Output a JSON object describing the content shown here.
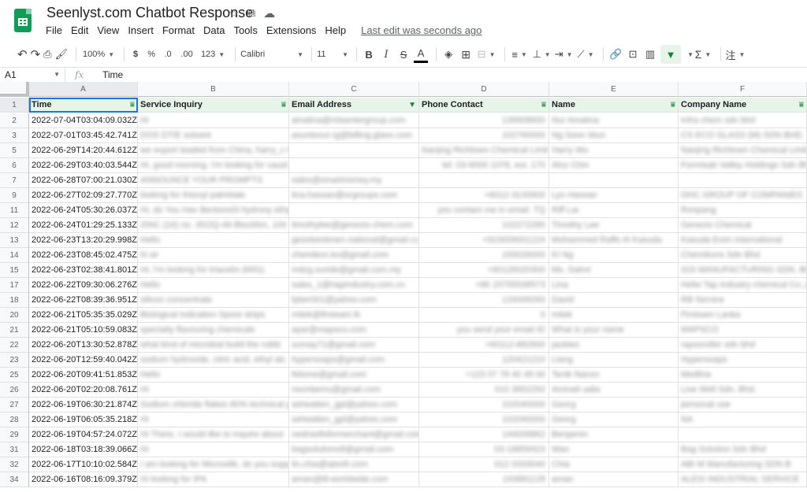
{
  "doc": {
    "title": "Seenlyst.com Chatbot Response",
    "icons": [
      "star-icon",
      "move-to-folder-icon",
      "cloud-status-icon"
    ]
  },
  "menu": [
    "File",
    "Edit",
    "View",
    "Insert",
    "Format",
    "Data",
    "Tools",
    "Extensions",
    "Help"
  ],
  "last_edit": "Last edit was seconds ago",
  "toolbar": {
    "zoom": "100%",
    "currency": "$",
    "percent": "%",
    "dec_less": ".0",
    "dec_more": ".00",
    "number_format": "123",
    "font": "Calibri",
    "font_size": "11",
    "bold": "B",
    "italic": "I",
    "strike": "S",
    "text_color": "A",
    "sum": "Σ"
  },
  "formula": {
    "cell_ref": "A1",
    "fx": "fx",
    "value": "Time"
  },
  "columns": [
    "A",
    "B",
    "C",
    "D",
    "E",
    "F"
  ],
  "headers": [
    "Time",
    "Service Inquiry",
    "Email Address",
    "Phone Contact",
    "Name",
    "Company Name"
  ],
  "rows": [
    {
      "n": "2",
      "time": "2022-07-04T03:04:09.032Z",
      "b": "Hi",
      "c": "ainatina@mtsentergroup.com",
      "d": "139908600",
      "e": "Nur Ainatina",
      "f": "Infra chem sdn bhd"
    },
    {
      "n": "3",
      "time": "2022-07-01T03:45:42.741Z",
      "b": "DOS DTIE solvent",
      "c": "asuntonur.rg@billing.glass.com",
      "d": "102760000",
      "e": "Ng Soon Wun",
      "f": "CS ECO GLASS (M) SDN BHD"
    },
    {
      "n": "5",
      "time": "2022-06-29T14:20:44.612Z",
      "b": "we export leaded from China, harry_c harry_wu@allyun.com",
      "c": "",
      "d": "Nanjing Richtown Chemical Limit",
      "e": "Harry Wu",
      "f": "Nanjing Richtown Chemical Limit"
    },
    {
      "n": "6",
      "time": "2022-06-29T03:40:03.544Z",
      "b": "Hi, good morning. I'm looking for caust afieschie@formisab.com.my",
      "c": "",
      "d": "tel: 03-9000 1078, ext. 170",
      "e": "Alnz Chin",
      "f": "Formisab Valley Holdings Sdn Bh"
    },
    {
      "n": "7",
      "time": "2022-06-28T07:00:21.030Z",
      "b": "ANNOUNCE YOUR PROMPTS",
      "c": "sales@smartmoney.my",
      "d": "",
      "e": "",
      "f": ""
    },
    {
      "n": "9",
      "time": "2022-06-27T02:09:27.770Z",
      "b": "looking for thionyl palmitate",
      "c": "lina.hassan@orgroups.com",
      "d": "+6012-3133900",
      "e": "Lyn Hassan",
      "f": "OHC GROUP OF COMPANIES"
    },
    {
      "n": "11",
      "time": "2022-06-24T05:30:26.037Z",
      "b": "Hi, do You Hav Bentonol3 hydroxy ethy fionpang@gmail.com",
      "c": "",
      "d": "you contact me in email. TQ",
      "e": "Riff Lai",
      "f": "Ronpang"
    },
    {
      "n": "12",
      "time": "2022-06-24T01:29:25.133Z",
      "b": "ZINC (16) no. 35/2Q-46-Blockfon, 100",
      "c": "timothylee@genezis-chem.com",
      "d": "102272280",
      "e": "Timothy Lee",
      "f": "Genezis Chemical"
    },
    {
      "n": "13",
      "time": "2022-06-23T13:20:29.998Z",
      "b": "Hello",
      "c": "gesobestimen.national@gmail.cc",
      "d": "+923009001224",
      "e": "Mohammed Raffe Al Kasuda",
      "f": "Kasuda Exim International"
    },
    {
      "n": "14",
      "time": "2022-06-23T08:45:02.475Z",
      "b": "hi sir",
      "c": "chemikon.ko@gmail.com",
      "d": "193026000",
      "e": "KI Ng",
      "f": "Chemikons Sdn Bhd"
    },
    {
      "n": "15",
      "time": "2022-06-23T02:38:41.801Z",
      "b": "Hi, I'm looking for triacetin (MIG)",
      "c": "mdzg.suride@gmail.com.my",
      "d": "+60126020300",
      "e": "Ms. Dahni",
      "f": "SOI MANUFACTURING SDN. BHD"
    },
    {
      "n": "17",
      "time": "2022-06-22T09:30:06.276Z",
      "b": "Hello",
      "c": "sales_1@hapindustry.com.cn",
      "d": "+86 15755538573",
      "e": "Lina",
      "f": "Hefei Tap Industry chemical Co.,L"
    },
    {
      "n": "18",
      "time": "2022-06-22T08:39:36.951Z",
      "b": "silicon concentrate",
      "c": "fyber001@yahoo.com",
      "d": "133009260",
      "e": "David",
      "f": "RB Service"
    },
    {
      "n": "20",
      "time": "2022-06-21T05:35:35.029Z",
      "b": "Biological indication Spore strips",
      "c": "mitek@firstsam.lk",
      "d": "0",
      "e": "mitek",
      "f": "Firstsam Lanka"
    },
    {
      "n": "21",
      "time": "2022-06-21T05:10:59.083Z",
      "b": "specialty flavouring chemicals",
      "c": "ayar@mapsco.com",
      "d": "you send your email ID",
      "e": "What is your name",
      "f": "MAPSCO"
    },
    {
      "n": "22",
      "time": "2022-06-20T13:30:52.878Z",
      "b": "what kind of microbial build the rubbi",
      "c": "sumay71@gmail.com",
      "d": "+60112-882600",
      "e": "jackteo",
      "f": "rapsoroller sdn bhd"
    },
    {
      "n": "23",
      "time": "2022-06-20T12:59:40.042Z",
      "b": "sodium hydroxide, citric acid, ethyl alc",
      "c": "hypersoaps@gmail.com",
      "d": "120421210",
      "e": "Liang",
      "f": "Hypersoaps"
    },
    {
      "n": "25",
      "time": "2022-06-20T09:41:51.853Z",
      "b": "Hello",
      "c": "febone@gmail.com",
      "d": "+123 07 78 40 49 00",
      "e": "Tenik Nanzo",
      "f": "Medline"
    },
    {
      "n": "26",
      "time": "2022-06-20T02:20:08.761Z",
      "b": "Hi",
      "c": "nsonbemu@gmail.com",
      "d": "010 3652292",
      "e": "Aminah adia",
      "f": "Live Well Sdn. Bhd."
    },
    {
      "n": "27",
      "time": "2022-06-19T06:30:21.874Z",
      "b": "Sodium chloride flakes 80% technical gr",
      "c": "seheatten_gpl@yahoo.com",
      "d": "102040000",
      "e": "Georg",
      "f": "personal use"
    },
    {
      "n": "28",
      "time": "2022-06-19T06:05:35.218Z",
      "b": "Hi",
      "c": "seheatten_gpl@yahoo.com",
      "d": "102040000",
      "e": "Georg",
      "f": "NA"
    },
    {
      "n": "29",
      "time": "2022-06-19T04:57:24.072Z",
      "b": "Hi There, I would like to inquire about",
      "c": "nedrastfoformerchant@gmail.com",
      "d": "144009862",
      "e": "Benjamin",
      "f": ""
    },
    {
      "n": "31",
      "time": "2022-06-18T03:18:39.066Z",
      "b": "Hi",
      "c": "bagsolutions8@gmail.com",
      "d": "03-18859423",
      "e": "Wan",
      "f": "Bag Solution Sdn Bhd"
    },
    {
      "n": "32",
      "time": "2022-06-17T10:10:02.584Z",
      "b": "I am looking for Microsilik, do you supp",
      "c": "lin.chia@abmfr.com",
      "d": "012-3333040",
      "e": "Chia",
      "f": "ABI M Manufacturing SDN B"
    },
    {
      "n": "34",
      "time": "2022-06-16T08:16:09.379Z",
      "b": "Hi looking for IPA",
      "c": "aman@ill-worldwide.com",
      "d": "193881128",
      "e": "aman",
      "f": "ALESI INDUSTRIAL SERVICE"
    }
  ]
}
